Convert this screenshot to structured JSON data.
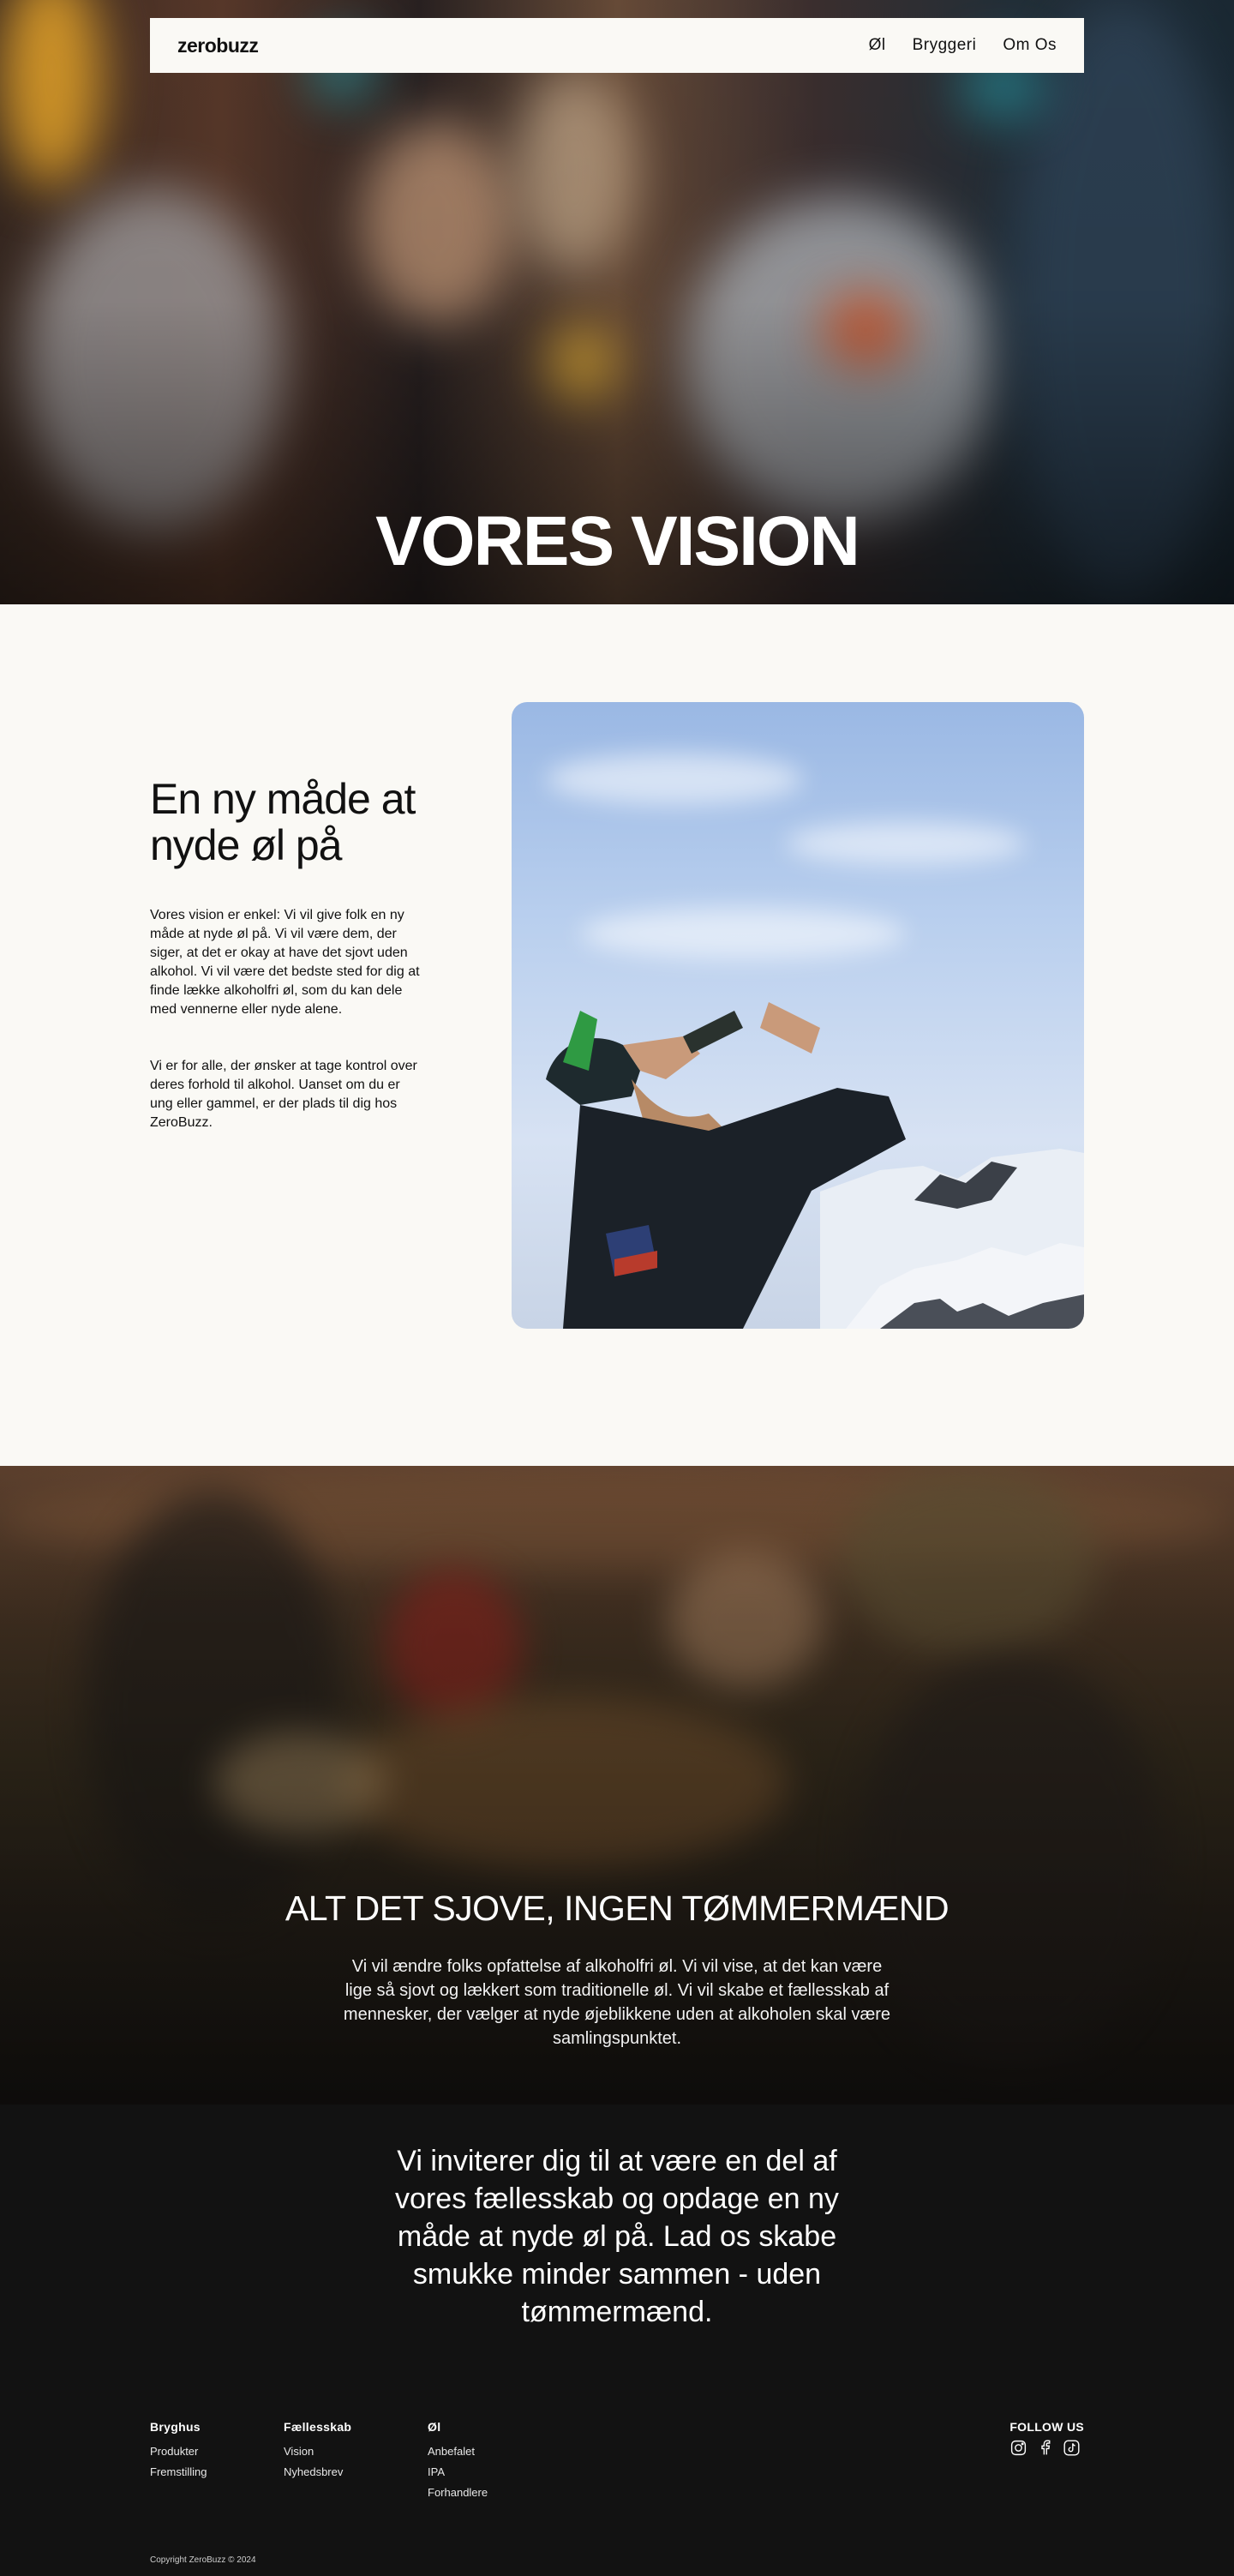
{
  "header": {
    "logo": "zerobuzz",
    "nav": [
      {
        "label": "Øl"
      },
      {
        "label": "Bryggeri"
      },
      {
        "label": "Om Os"
      }
    ]
  },
  "hero": {
    "title": "VORES VISION"
  },
  "vision": {
    "heading": "En ny måde at nyde øl på",
    "paragraph1": "Vores vision er enkel: Vi vil give folk en ny måde at nyde øl på. Vi vil være dem, der siger, at det er okay at have det sjovt uden alkohol. Vi vil være det bedste sted for dig at finde lække alkoholfri øl, som du kan dele med vennerne eller nyde alene.",
    "paragraph2": "Vi er for alle, der ønsker at tage kontrol over deres forhold til alkohol. Uanset om du er ung eller gammel, er der plads til dig hos ZeroBuzz."
  },
  "fun": {
    "heading": "ALT DET SJOVE, INGEN TØMMERMÆND",
    "text": "Vi vil ændre folks opfattelse af alkoholfri øl. Vi vil vise, at det kan være lige så sjovt og lækkert som traditionelle øl. Vi vil skabe et fællesskab af mennesker, der vælger at nyde øjeblikkene uden at alkoholen skal være samlingspunktet."
  },
  "invite": {
    "text": "Vi inviterer dig til at være en del af vores fællesskab og opdage en ny måde at nyde øl på. Lad os skabe smukke minder sammen - uden tømmermænd."
  },
  "footer": {
    "columns": [
      {
        "heading": "Bryghus",
        "links": [
          "Produkter",
          "Fremstilling"
        ]
      },
      {
        "heading": "Fællesskab",
        "links": [
          "Vision",
          "Nyhedsbrev"
        ]
      },
      {
        "heading": "Øl",
        "links": [
          "Anbefalet",
          "IPA",
          "Forhandlere"
        ]
      }
    ],
    "follow": {
      "heading": "FOLLOW US",
      "icons": [
        "instagram-icon",
        "facebook-icon",
        "tiktok-icon"
      ]
    },
    "copyright": "Copyright ZeroBuzz © 2024"
  },
  "colors": {
    "background": "#faf9f5",
    "dark": "#121212",
    "text": "#111111"
  }
}
